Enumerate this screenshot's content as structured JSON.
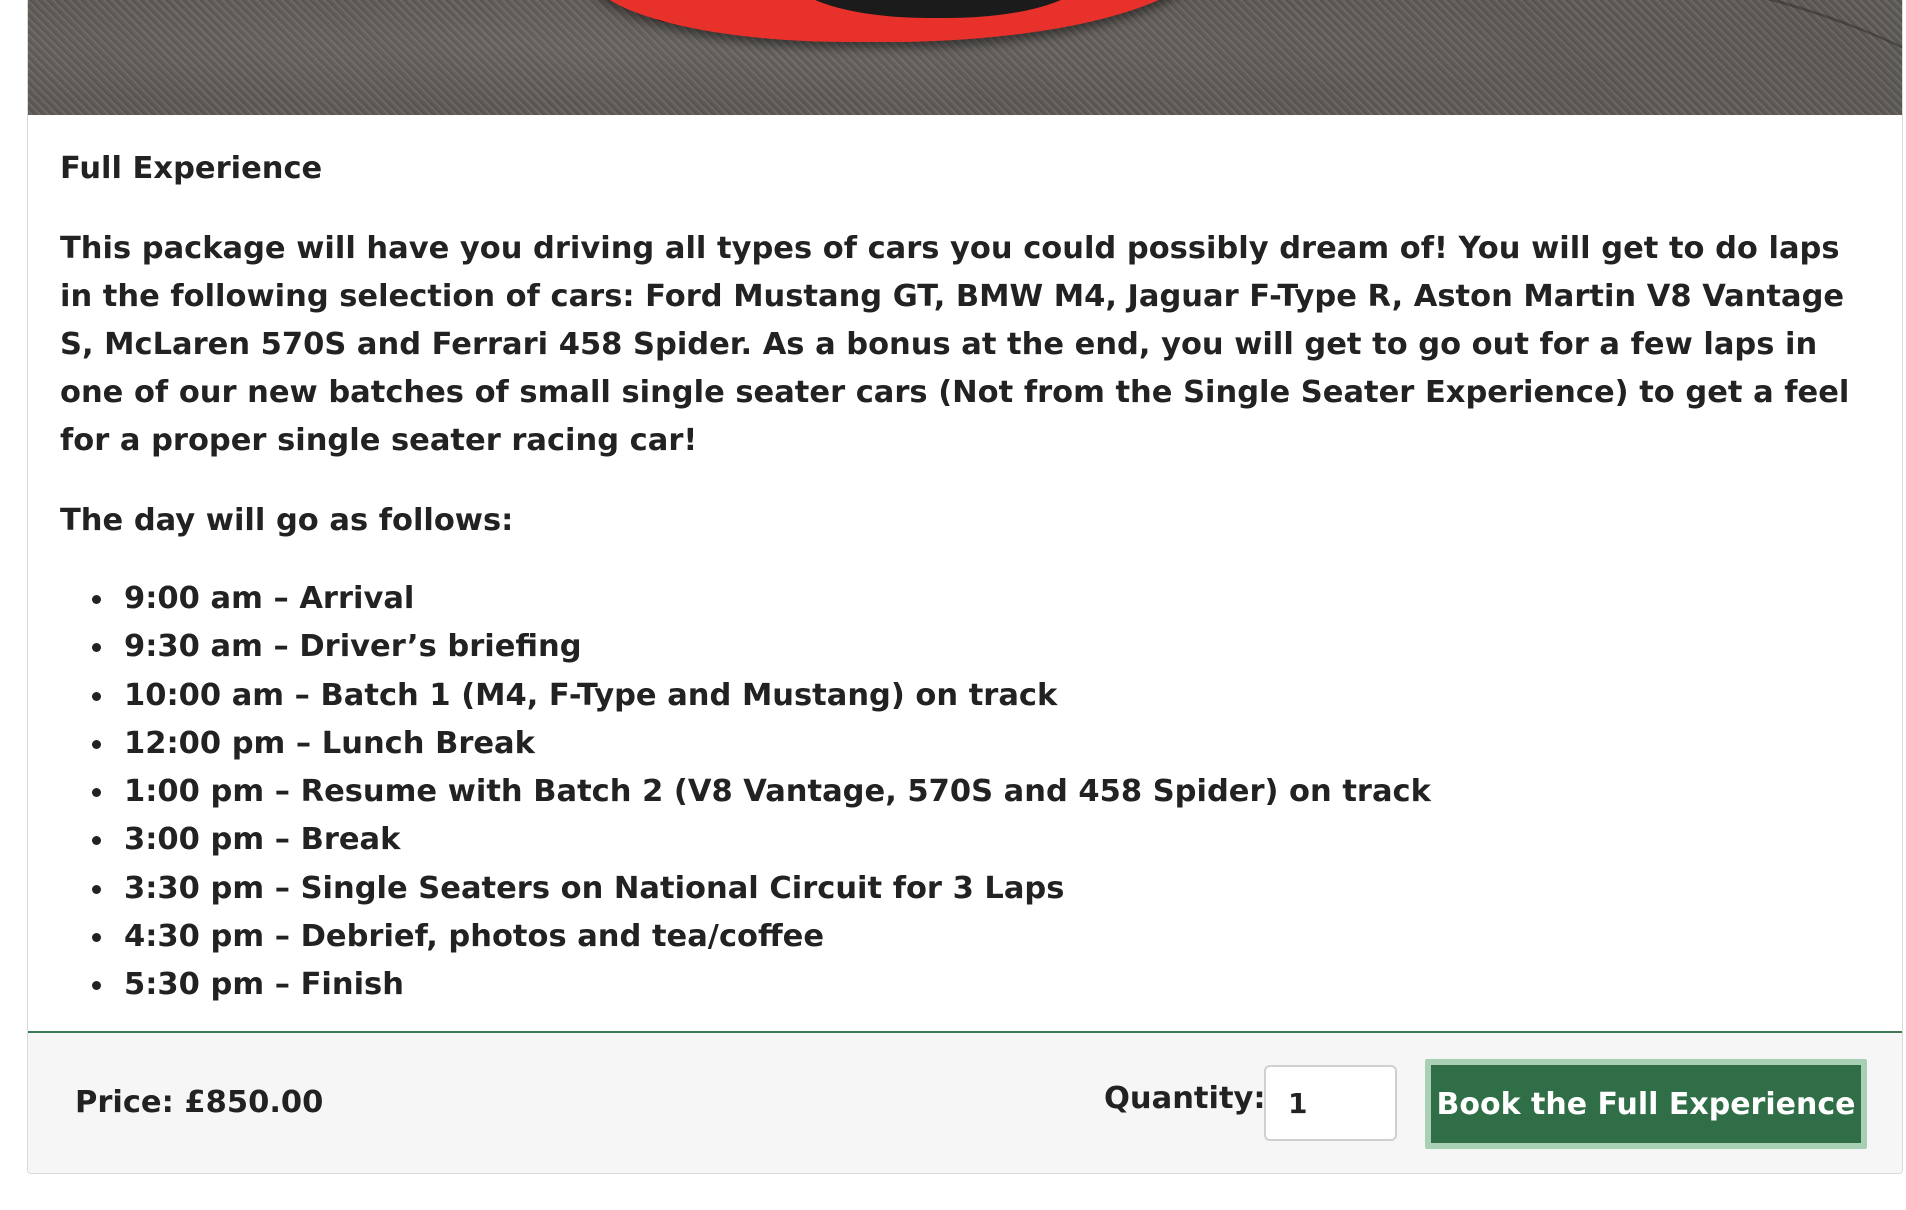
{
  "package": {
    "title": "Full Experience",
    "description": "This package will have you driving all types of cars you could possibly dream of! You will get to do laps in the following selection of cars: Ford Mustang GT, BMW M4, Jaguar F-Type R, Aston Martin V8 Vantage S, McLaren 570S and Ferrari 458 Spider. As a bonus at the end, you will get to go out for a few laps in one of our new batches of small single seater cars (Not from the Single Seater Experience) to get a feel for a proper single seater racing car!",
    "intro": "The day will go as follows:",
    "schedule": [
      "9:00 am – Arrival",
      "9:30 am – Driver’s briefing",
      "10:00 am – Batch 1 (M4, F-Type and Mustang) on track",
      "12:00 pm – Lunch Break",
      "1:00 pm – Resume with Batch 2 (V8 Vantage, 570S and 458 Spider) on track",
      "3:00 pm – Break",
      "3:30 pm – Single Seaters on National Circuit for 3 Laps",
      "4:30 pm – Debrief, photos and tea/coffee",
      "5:30 pm – Finish"
    ]
  },
  "purchase": {
    "price_text": "Price: £850.00",
    "quantity_label": "Quantity:",
    "quantity_value": "1",
    "book_label": "Book the Full Experience"
  },
  "colors": {
    "accent_green": "#2f6e47",
    "button_border": "#a9cfb4",
    "footer_bg": "#f6f6f6",
    "car_red": "#e8312b"
  }
}
